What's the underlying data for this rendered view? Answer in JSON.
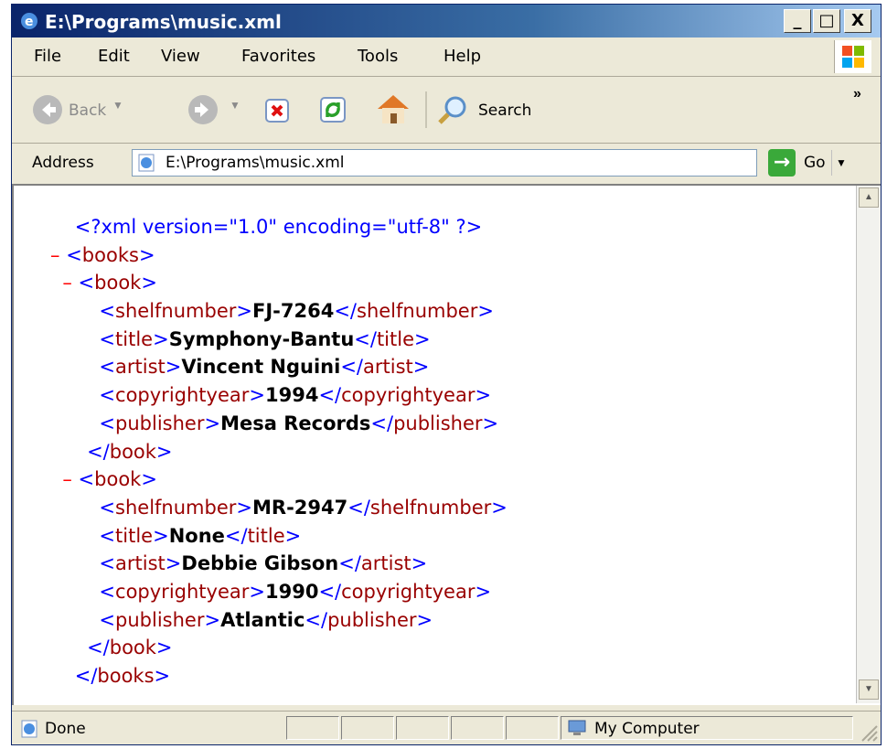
{
  "window": {
    "title": "E:\\Programs\\music.xml",
    "controls": [
      "_",
      "□",
      "X"
    ]
  },
  "menubar": {
    "items": [
      "File",
      "Edit",
      "View",
      "Favorites",
      "Tools",
      "Help"
    ]
  },
  "toolbar": {
    "back_label": "Back",
    "search_label": "Search",
    "more_label": "»",
    "icons": [
      "back-icon",
      "forward-icon",
      "stop-icon",
      "refresh-icon",
      "home-icon",
      "search-icon"
    ]
  },
  "address": {
    "label": "Address",
    "value": "E:\\Programs\\music.xml",
    "go_label": "Go"
  },
  "document": {
    "lines": [
      {
        "ind": "  ",
        "marker": "",
        "parts": [
          [
            "b",
            "<?xml version=\"1.0\" encoding=\"utf-8\" ?>"
          ]
        ]
      },
      {
        "ind": "",
        "marker": "– ",
        "parts": [
          [
            "b",
            "<"
          ],
          [
            "r",
            "books"
          ],
          [
            "b",
            ">"
          ]
        ]
      },
      {
        "ind": "  ",
        "marker": "– ",
        "parts": [
          [
            "b",
            "<"
          ],
          [
            "r",
            "book"
          ],
          [
            "b",
            ">"
          ]
        ]
      },
      {
        "ind": "      ",
        "marker": "",
        "parts": [
          [
            "b",
            "<"
          ],
          [
            "r",
            "shelfnumber"
          ],
          [
            "b",
            ">"
          ],
          [
            "t",
            "FJ-7264"
          ],
          [
            "b",
            "</"
          ],
          [
            "r",
            "shelfnumber"
          ],
          [
            "b",
            ">"
          ]
        ]
      },
      {
        "ind": "      ",
        "marker": "",
        "parts": [
          [
            "b",
            "<"
          ],
          [
            "r",
            "title"
          ],
          [
            "b",
            ">"
          ],
          [
            "t",
            "Symphony-Bantu"
          ],
          [
            "b",
            "</"
          ],
          [
            "r",
            "title"
          ],
          [
            "b",
            ">"
          ]
        ]
      },
      {
        "ind": "      ",
        "marker": "",
        "parts": [
          [
            "b",
            "<"
          ],
          [
            "r",
            "artist"
          ],
          [
            "b",
            ">"
          ],
          [
            "t",
            "Vincent Nguini"
          ],
          [
            "b",
            "</"
          ],
          [
            "r",
            "artist"
          ],
          [
            "b",
            ">"
          ]
        ]
      },
      {
        "ind": "      ",
        "marker": "",
        "parts": [
          [
            "b",
            "<"
          ],
          [
            "r",
            "copyrightyear"
          ],
          [
            "b",
            ">"
          ],
          [
            "t",
            "1994"
          ],
          [
            "b",
            "</"
          ],
          [
            "r",
            "copyrightyear"
          ],
          [
            "b",
            ">"
          ]
        ]
      },
      {
        "ind": "      ",
        "marker": "",
        "parts": [
          [
            "b",
            "<"
          ],
          [
            "r",
            "publisher"
          ],
          [
            "b",
            ">"
          ],
          [
            "t",
            "Mesa Records"
          ],
          [
            "b",
            "</"
          ],
          [
            "r",
            "publisher"
          ],
          [
            "b",
            ">"
          ]
        ]
      },
      {
        "ind": "    ",
        "marker": "",
        "parts": [
          [
            "b",
            "</"
          ],
          [
            "r",
            "book"
          ],
          [
            "b",
            ">"
          ]
        ]
      },
      {
        "ind": "  ",
        "marker": "– ",
        "parts": [
          [
            "b",
            "<"
          ],
          [
            "r",
            "book"
          ],
          [
            "b",
            ">"
          ]
        ]
      },
      {
        "ind": "      ",
        "marker": "",
        "parts": [
          [
            "b",
            "<"
          ],
          [
            "r",
            "shelfnumber"
          ],
          [
            "b",
            ">"
          ],
          [
            "t",
            "MR-2947"
          ],
          [
            "b",
            "</"
          ],
          [
            "r",
            "shelfnumber"
          ],
          [
            "b",
            ">"
          ]
        ]
      },
      {
        "ind": "      ",
        "marker": "",
        "parts": [
          [
            "b",
            "<"
          ],
          [
            "r",
            "title"
          ],
          [
            "b",
            ">"
          ],
          [
            "t",
            "None"
          ],
          [
            "b",
            "</"
          ],
          [
            "r",
            "title"
          ],
          [
            "b",
            ">"
          ]
        ]
      },
      {
        "ind": "      ",
        "marker": "",
        "parts": [
          [
            "b",
            "<"
          ],
          [
            "r",
            "artist"
          ],
          [
            "b",
            ">"
          ],
          [
            "t",
            "Debbie Gibson"
          ],
          [
            "b",
            "</"
          ],
          [
            "r",
            "artist"
          ],
          [
            "b",
            ">"
          ]
        ]
      },
      {
        "ind": "      ",
        "marker": "",
        "parts": [
          [
            "b",
            "<"
          ],
          [
            "r",
            "copyrightyear"
          ],
          [
            "b",
            ">"
          ],
          [
            "t",
            "1990"
          ],
          [
            "b",
            "</"
          ],
          [
            "r",
            "copyrightyear"
          ],
          [
            "b",
            ">"
          ]
        ]
      },
      {
        "ind": "      ",
        "marker": "",
        "parts": [
          [
            "b",
            "<"
          ],
          [
            "r",
            "publisher"
          ],
          [
            "b",
            ">"
          ],
          [
            "t",
            "Atlantic"
          ],
          [
            "b",
            "</"
          ],
          [
            "r",
            "publisher"
          ],
          [
            "b",
            ">"
          ]
        ]
      },
      {
        "ind": "    ",
        "marker": "",
        "parts": [
          [
            "b",
            "</"
          ],
          [
            "r",
            "book"
          ],
          [
            "b",
            ">"
          ]
        ]
      },
      {
        "ind": "  ",
        "marker": "",
        "parts": [
          [
            "b",
            "</"
          ],
          [
            "r",
            "books"
          ],
          [
            "b",
            ">"
          ]
        ]
      }
    ]
  },
  "status": {
    "text": "Done",
    "zone": "My Computer"
  },
  "colors": {
    "title_bar": "#0a246a",
    "markup": "#0000ff",
    "tag_name": "#990000",
    "collapse_marker": "#ff0000",
    "text_value": "#000000"
  }
}
